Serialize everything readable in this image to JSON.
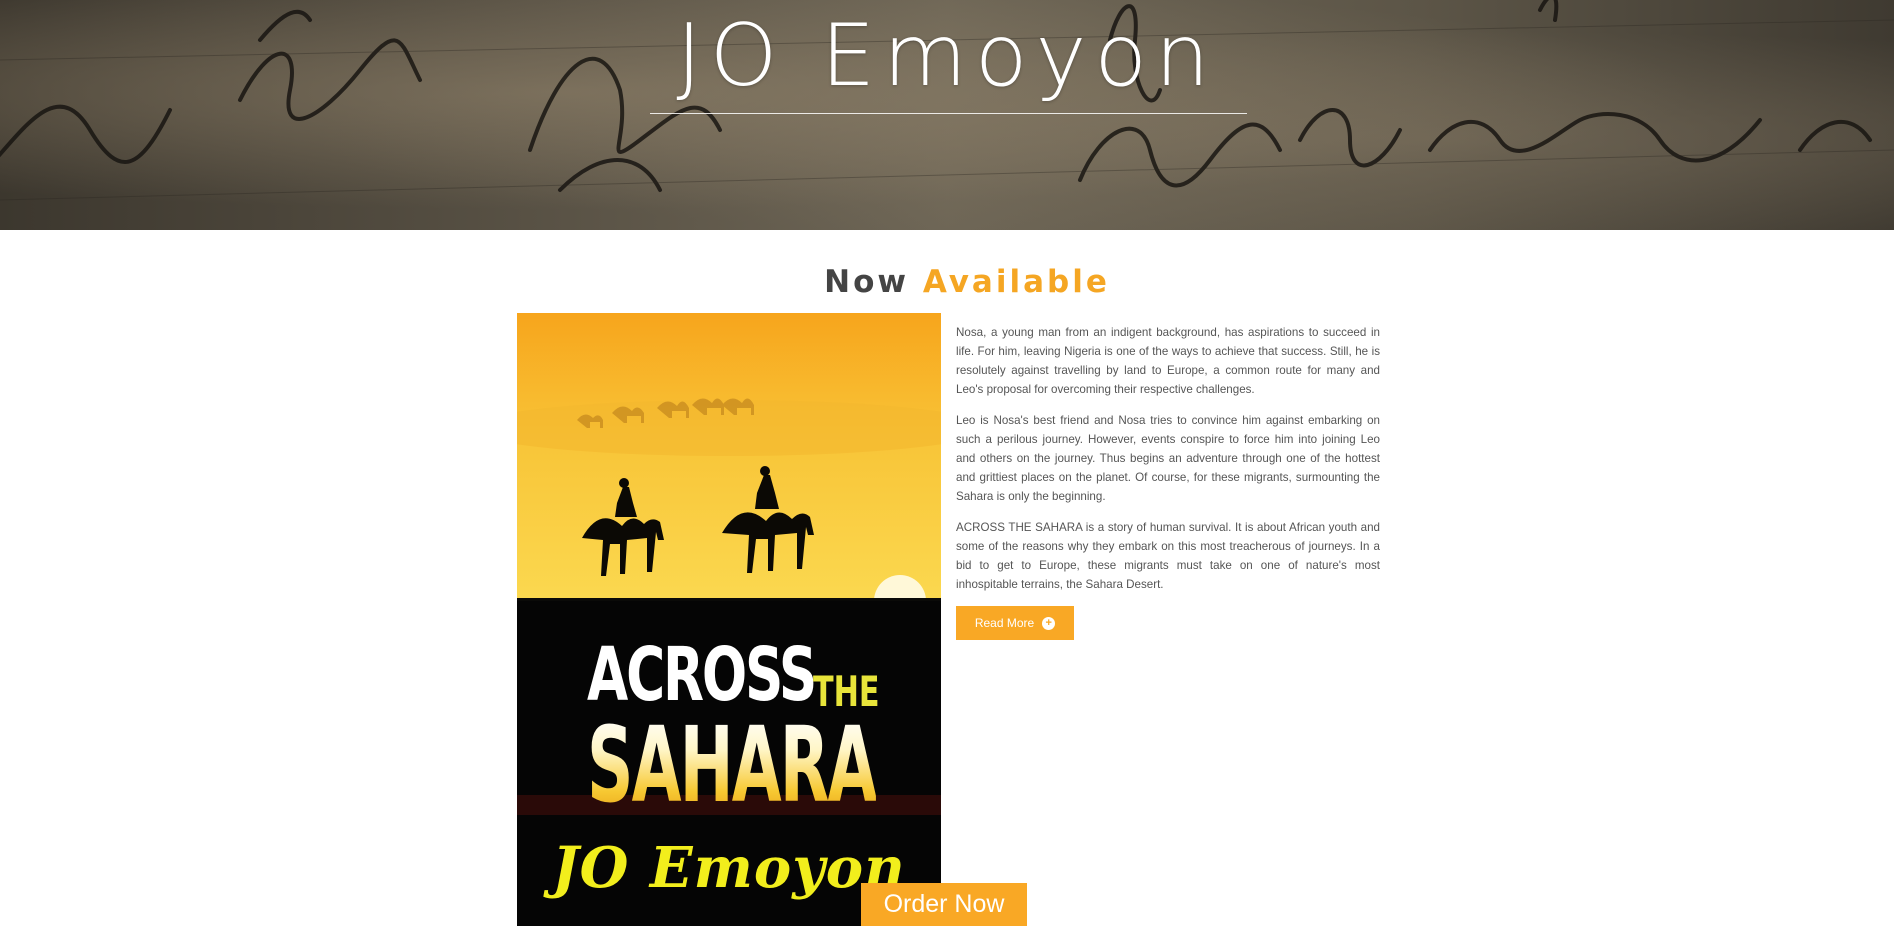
{
  "hero": {
    "title": "JO Emoyon"
  },
  "section": {
    "heading_part1": "Now",
    "heading_part2": "Available"
  },
  "book": {
    "cover_title_word1": "ACROSS",
    "cover_title_word2": "THE",
    "cover_title_word3": "SAHARA",
    "cover_author": "JO Emoyon",
    "paragraphs": [
      "Nosa, a young man from an indigent background, has aspirations to succeed in life. For him, leaving Nigeria is one of the ways to achieve that success. Still, he is resolutely against travelling by land to Europe, a common route for many and Leo's proposal for overcoming their respective challenges.",
      "Leo is Nosa's best friend and Nosa tries to convince him against embarking on such a perilous journey. However, events conspire to force him into joining Leo and others on the journey. Thus begins an adventure through one of the hottest and grittiest places on the planet. Of course, for these migrants, surmounting the Sahara is only the beginning.",
      "ACROSS THE SAHARA is a story of human survival. It is about African youth and some of the reasons why they embark on this most treacherous of journeys. In a bid to get to Europe, these migrants must take on one of nature's most inhospitable terrains, the Sahara Desert."
    ]
  },
  "buttons": {
    "read_more": "Read More",
    "read_more_icon": "plus-circle-icon",
    "order_now": "Order Now"
  },
  "colors": {
    "accent": "#f9a825",
    "heading_dark": "#444444",
    "body_text": "#555555"
  }
}
